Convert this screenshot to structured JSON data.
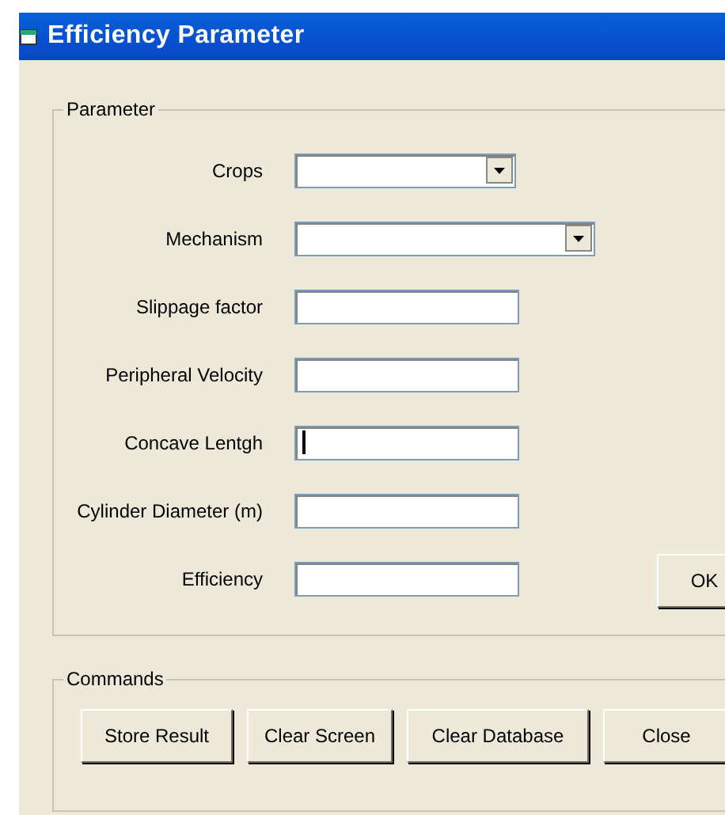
{
  "window": {
    "title": "Efficiency Parameter"
  },
  "parameter_group": {
    "title": "Parameter",
    "fields": [
      {
        "label": "Crops",
        "kind": "combo",
        "wide": false
      },
      {
        "label": "Mechanism",
        "kind": "combo",
        "wide": true
      },
      {
        "label": "Slippage factor",
        "kind": "text",
        "focused": false
      },
      {
        "label": "Peripheral Velocity",
        "kind": "text",
        "focused": false
      },
      {
        "label": "Concave Lentgh",
        "kind": "text",
        "focused": true
      },
      {
        "label": "Cylinder Diameter (m)",
        "kind": "text",
        "focused": false
      },
      {
        "label": "Efficiency",
        "kind": "text",
        "focused": false
      }
    ],
    "ok_button": "OK"
  },
  "commands_group": {
    "title": "Commands",
    "buttons": [
      "Store Result",
      "Clear Screen",
      "Clear Database",
      "Close"
    ]
  }
}
